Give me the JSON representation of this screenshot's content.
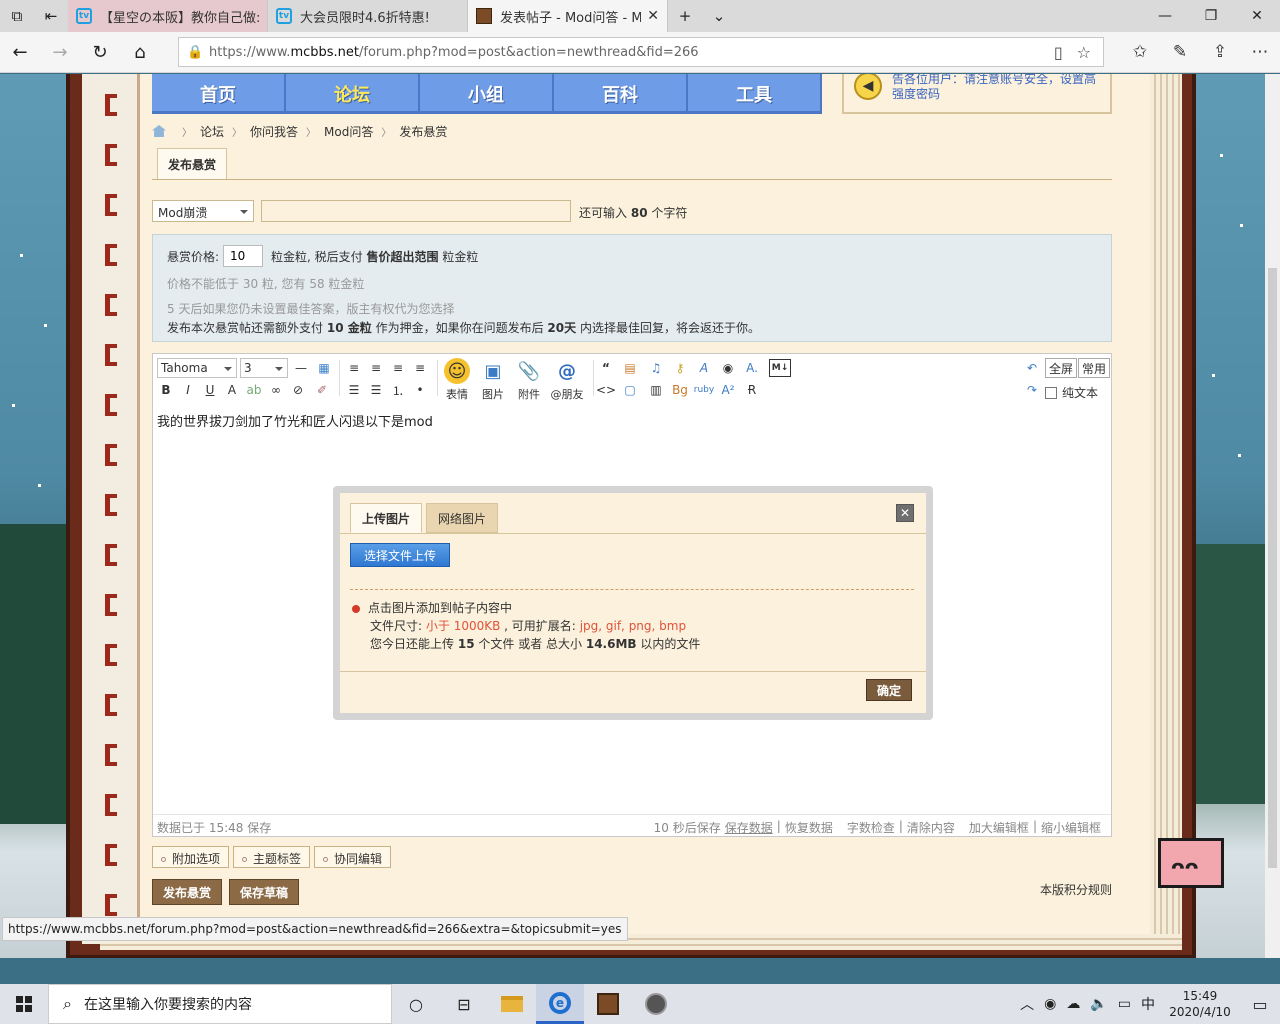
{
  "browser": {
    "tabs": [
      {
        "title": "【星空の本阪】教你自己做:",
        "style": "pink",
        "favicon": "bilibili-icon"
      },
      {
        "title": "大会员限时4.6折特惠!",
        "style": "normal",
        "favicon": "bilibili-icon"
      },
      {
        "title": "发表帖子 - Mod问答 - M",
        "style": "active",
        "favicon": "minecraft-block-icon"
      }
    ],
    "url_prefix": "https://www.",
    "url_host": "mcbbs.net",
    "url_path": "/forum.php?mod=post&action=newthread&fid=266",
    "status_url": "https://www.mcbbs.net/forum.php?mod=post&action=newthread&fid=266&extra=&topicsubmit=yes"
  },
  "site": {
    "nav": [
      {
        "label": "首页",
        "active": false
      },
      {
        "label": "论坛",
        "active": true
      },
      {
        "label": "小组",
        "active": false
      },
      {
        "label": "百科",
        "active": false
      },
      {
        "label": "工具",
        "active": false
      }
    ],
    "notice_line1": "告各位用户：请注意账号安全，设置高",
    "notice_line2": "强度密码"
  },
  "breadcrumb": [
    "论坛",
    "你问我答",
    "Mod问答",
    "发布悬赏"
  ],
  "page_tab": "发布悬赏",
  "post": {
    "type_value": "Mod崩溃",
    "remain_prefix": "还可输入",
    "remain_count": "80",
    "remain_suffix": "个字符"
  },
  "reward": {
    "label": "悬赏价格:",
    "price": "10",
    "after_price_1": "粒金粒, 税后支付",
    "after_price_bold": "售价超出范围",
    "after_price_2": "粒金粒",
    "hint_min": "价格不能低于 30 粒, 您有 58 粒金粒",
    "hint_days": "5 天后如果您仍未设置最佳答案，版主有权代为您选择",
    "deposit_1": "发布本次悬赏帖还需额外支付",
    "deposit_amount": "10 金粒",
    "deposit_2": "作为押金，如果你在问题发布后",
    "deposit_days": "20天",
    "deposit_3": "内选择最佳回复，将会返还于你。"
  },
  "editor": {
    "font": "Tahoma",
    "size": "3",
    "emoji_label": "表情",
    "image_label": "图片",
    "attach_label": "附件",
    "mention_label": "@朋友",
    "fullscreen": "全屏",
    "common": "常用",
    "plain_text": "纯文本",
    "body_text": "我的世界拔刀剑加了竹光和匠人闪退以下是mod",
    "saved_at": "数据已于 15:48 保存",
    "autosave": "10 秒后保存",
    "save_data": "保存数据",
    "restore_data": "恢复数据",
    "word_check": "字数检查",
    "clear": "清除内容",
    "enlarge": "加大编辑框",
    "shrink": "缩小编辑框"
  },
  "options": [
    "附加选项",
    "主题标签",
    "协同编辑"
  ],
  "actions": {
    "publish": "发布悬赏",
    "draft": "保存草稿",
    "rules": "本版积分规则"
  },
  "modal": {
    "tab_upload": "上传图片",
    "tab_web": "网络图片",
    "upload_button": "选择文件上传",
    "info_line1": "点击图片添加到帖子内容中",
    "size_label": "文件尺寸:",
    "size_value": "小于 1000KB",
    "ext_label": ", 可用扩展名:",
    "ext_value": "jpg, gif, png, bmp",
    "today_1": "您今日还能上传",
    "today_count": "15",
    "today_2": "个文件 或者 总大小",
    "today_size": "14.6MB",
    "today_3": "以内的文件",
    "ok": "确定"
  },
  "taskbar": {
    "search_placeholder": "在这里输入你要搜索的内容",
    "time": "15:49",
    "date": "2020/4/10",
    "ime": "中"
  }
}
